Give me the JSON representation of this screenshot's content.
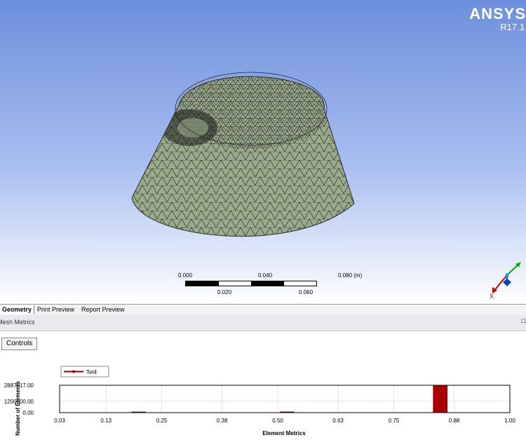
{
  "brand": {
    "name": "ANSYS",
    "version": "R17.1"
  },
  "scale_bar": {
    "top_labels": [
      "0.000",
      "0.040",
      "0.080 (m)"
    ],
    "bottom_labels": [
      "0.020",
      "0.060"
    ]
  },
  "triad": {
    "x_label": "X"
  },
  "tabs": [
    {
      "label": "Geometry",
      "active": true
    },
    {
      "label": "Print Preview",
      "active": false
    },
    {
      "label": "Report Preview",
      "active": false
    }
  ],
  "panel": {
    "title": "Mesh Metrics",
    "pin_glyph": "□"
  },
  "controls_label": "Controls",
  "colors": {
    "model_fill": "#9aab8a",
    "mesh_line": "#1a1a1a",
    "bar": "#aa0000",
    "legend_line": "#8b0000"
  },
  "chart_data": {
    "type": "bar",
    "legend": [
      "Tet4"
    ],
    "ylabel": "Number of Elements",
    "xlabel": "Element Metrics",
    "xlim": [
      0.03,
      1.0
    ],
    "ylim": [
      0,
      2887617.0
    ],
    "xticks": [
      "0.03",
      "0.13",
      "0.25",
      "0.38",
      "0.50",
      "0.63",
      "0.75",
      "0.88",
      "1.00"
    ],
    "yticks": [
      "2887617.00",
      "1200000.00",
      "0.00"
    ],
    "bars": [
      {
        "x0": 0.185,
        "x1": 0.215,
        "value": 20000
      },
      {
        "x0": 0.505,
        "x1": 0.535,
        "value": 80000
      },
      {
        "x0": 0.835,
        "x1": 0.865,
        "value": 2887617
      }
    ]
  }
}
